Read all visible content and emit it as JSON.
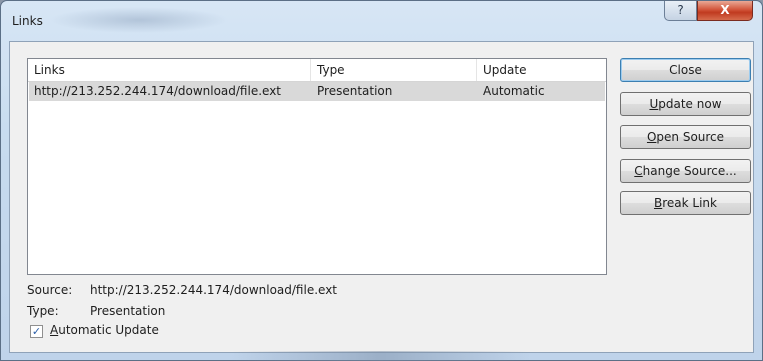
{
  "window": {
    "title": "Links",
    "help_glyph": "?",
    "close_glyph": "X"
  },
  "list": {
    "columns": [
      "Links",
      "Type",
      "Update"
    ],
    "rows": [
      {
        "link": "http://213.252.244.174/download/file.ext",
        "type": "Presentation",
        "update": "Automatic"
      }
    ]
  },
  "buttons": {
    "close": "Close",
    "update_now": "Update now",
    "open_source": "Open Source",
    "change_source": "Change Source...",
    "break_link": "Break Link"
  },
  "details": {
    "source_label": "Source:",
    "source_value": "http://213.252.244.174/download/file.ext",
    "type_label": "Type:",
    "type_value": "Presentation",
    "automatic_update_label": "Automatic Update",
    "automatic_update_checked": true
  },
  "icons": {
    "help": "help-icon",
    "close": "close-icon",
    "check": "checkmark-icon"
  }
}
